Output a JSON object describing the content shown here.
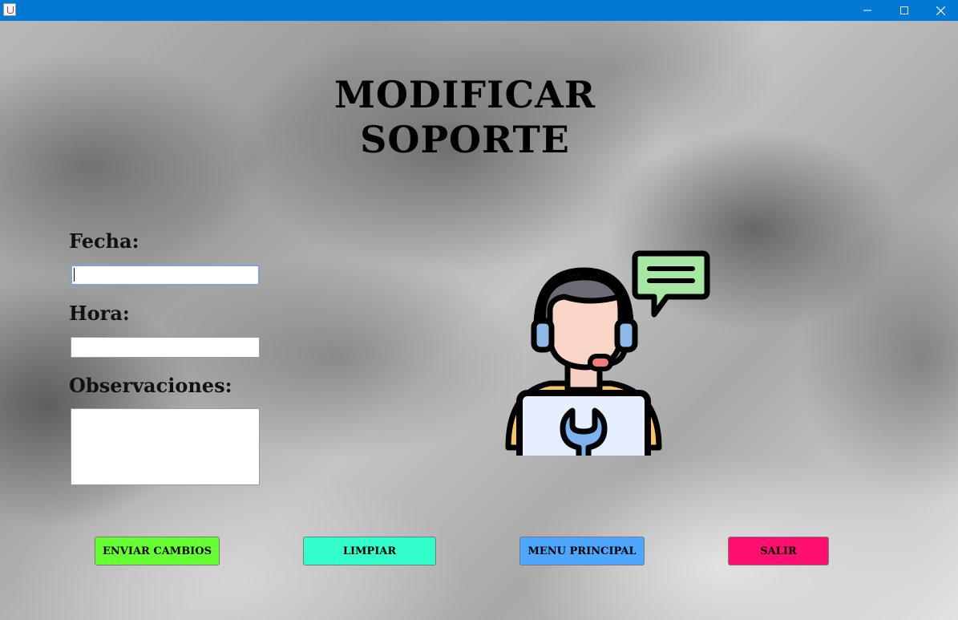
{
  "window": {
    "title": "",
    "titlebar_color": "#0078d4",
    "controls": {
      "minimize_icon": "minimize-icon",
      "maximize_icon": "maximize-icon",
      "close_icon": "close-icon"
    }
  },
  "page": {
    "title": "MODIFICAR SOPORTE"
  },
  "form": {
    "fecha_label": "Fecha:",
    "fecha_value": "",
    "hora_label": "Hora:",
    "hora_value": "",
    "observaciones_label": "Observaciones:",
    "observaciones_value": ""
  },
  "illustration": {
    "icon": "support-technician-icon"
  },
  "actions": {
    "enviar_label": "ENVIAR CAMBIOS",
    "enviar_color": "#66ff33",
    "limpiar_label": "LIMPIAR",
    "limpiar_color": "#33ffcc",
    "menu_label": "MENU PRINCIPAL",
    "menu_color": "#4da6ff",
    "salir_label": "SALIR",
    "salir_color": "#ff0f6f"
  }
}
